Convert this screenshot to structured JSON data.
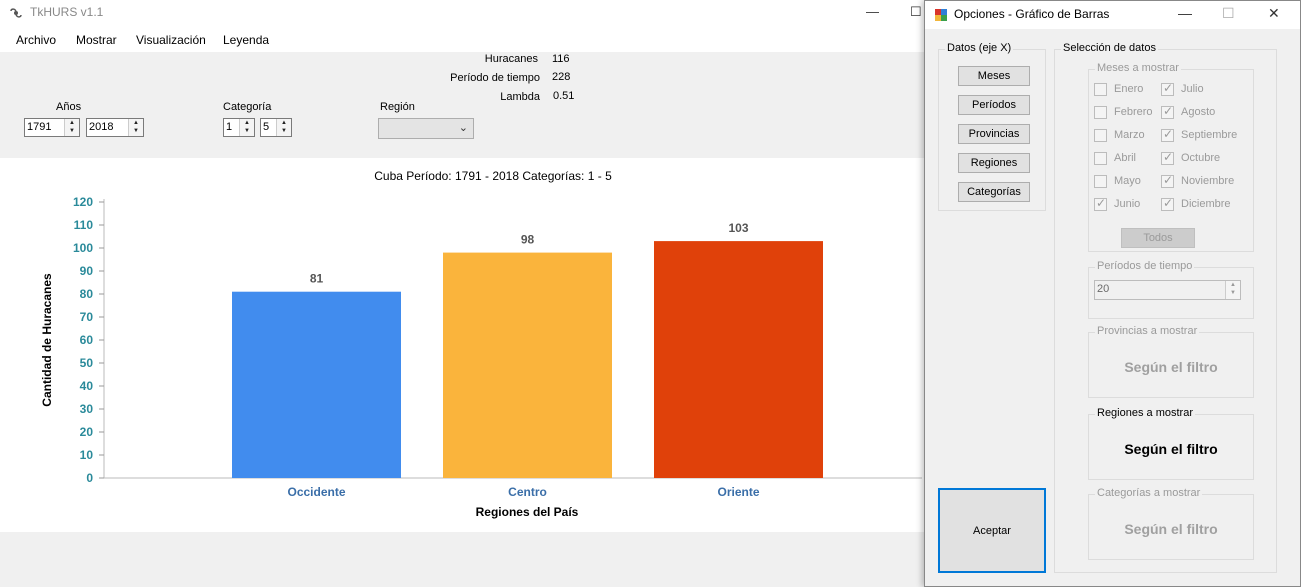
{
  "app": {
    "title": "TkHURS v1.1",
    "window_controls": {
      "minimize": "—",
      "maximize": "☐"
    }
  },
  "menu": [
    {
      "label": "Archivo"
    },
    {
      "label": "Mostrar"
    },
    {
      "label": "Visualización"
    },
    {
      "label": "Leyenda"
    }
  ],
  "stats": {
    "huracanes_label": "Huracanes",
    "huracanes_value": "116",
    "periodo_label": "Período de tiempo",
    "periodo_value": "228",
    "lambda_label": "Lambda",
    "lambda_value": "0.51"
  },
  "filters": {
    "anos_label": "Años",
    "ano_desde": "1791",
    "ano_hasta": "2018",
    "categoria_label": "Categoría",
    "cat_desde": "1",
    "cat_hasta": "5",
    "region_label": "Región",
    "region_value": ""
  },
  "chart_data": {
    "type": "bar",
    "title": "Cuba Período: 1791 - 2018 Categorías: 1 - 5",
    "xlabel": "Regiones del País",
    "ylabel": "Cantidad de Huracanes",
    "categories": [
      "Occidente",
      "Centro",
      "Oriente"
    ],
    "values": [
      81,
      98,
      103
    ],
    "colors": [
      "#418cee",
      "#fab43c",
      "#e0410a"
    ],
    "ylim": [
      0,
      120
    ],
    "yticks": [
      "0",
      "10",
      "20",
      "30",
      "40",
      "50",
      "60",
      "70",
      "80",
      "90",
      "100",
      "110",
      "120"
    ],
    "grid": false,
    "legend": "none",
    "tick_color": "#2a8a9a",
    "category_color": "#3a6ea8"
  },
  "dialog": {
    "title": "Opciones - Gráfico de Barras",
    "window_controls": {
      "minimize": "—",
      "maximize": "☐",
      "close": "✕"
    },
    "datos_group": {
      "legend": "Datos (eje X)",
      "buttons": [
        "Meses",
        "Períodos",
        "Provincias",
        "Regiones",
        "Categorías"
      ]
    },
    "seleccion_group": {
      "legend": "Selección de datos",
      "meses": {
        "legend": "Meses a mostrar",
        "col1": [
          {
            "label": "Enero",
            "checked": false
          },
          {
            "label": "Febrero",
            "checked": false
          },
          {
            "label": "Marzo",
            "checked": false
          },
          {
            "label": "Abril",
            "checked": false
          },
          {
            "label": "Mayo",
            "checked": false
          },
          {
            "label": "Junio",
            "checked": true
          }
        ],
        "col2": [
          {
            "label": "Julio",
            "checked": true
          },
          {
            "label": "Agosto",
            "checked": true
          },
          {
            "label": "Septiembre",
            "checked": true
          },
          {
            "label": "Octubre",
            "checked": true
          },
          {
            "label": "Noviembre",
            "checked": true
          },
          {
            "label": "Diciembre",
            "checked": true
          }
        ],
        "todos_label": "Todos"
      },
      "periodos": {
        "legend": "Períodos de tiempo",
        "value": "20"
      },
      "provincias": {
        "legend": "Provincias a mostrar",
        "text": "Según el filtro"
      },
      "regiones": {
        "legend": "Regiones a mostrar",
        "text": "Según el filtro"
      },
      "categorias": {
        "legend": "Categorías a mostrar",
        "text": "Según el filtro"
      }
    },
    "accept_label": "Aceptar"
  }
}
